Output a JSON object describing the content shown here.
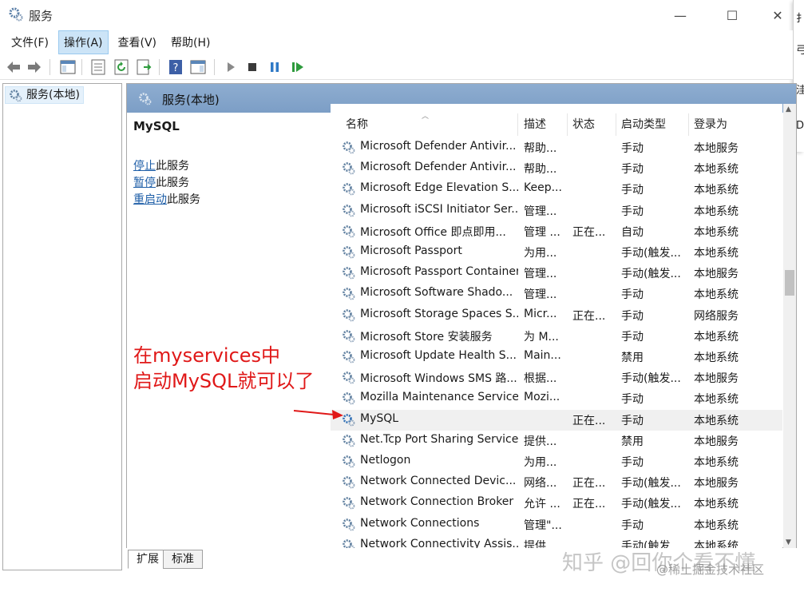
{
  "window": {
    "title": "服务",
    "minimize_glyph": "—",
    "maximize_glyph": "☐",
    "close_glyph": "✕"
  },
  "side_strip": [
    "扌",
    "弓",
    "洼",
    "D"
  ],
  "menu": [
    {
      "label": "文件(F)",
      "active": false
    },
    {
      "label": "操作(A)",
      "active": true
    },
    {
      "label": "查看(V)",
      "active": false
    },
    {
      "label": "帮助(H)",
      "active": false
    }
  ],
  "toolbar_icons": [
    "back-arrow-icon",
    "forward-arrow-icon",
    "show-console-tree-icon",
    "properties-icon",
    "refresh-icon",
    "export-list-icon",
    "help-icon",
    "action-pane-icon",
    "start-service-icon",
    "stop-service-icon",
    "pause-service-icon",
    "restart-service-icon"
  ],
  "tree": {
    "label": "服务(本地)"
  },
  "header": {
    "title": "服务(本地)"
  },
  "extended": {
    "service_name": "MySQL",
    "actions": [
      {
        "link": "停止",
        "suffix": "此服务"
      },
      {
        "link": "暂停",
        "suffix": "此服务"
      },
      {
        "link": "重启动",
        "suffix": "此服务"
      }
    ]
  },
  "annotation": {
    "line1": "在myservices中",
    "line2": "启动MySQL就可以了",
    "color": "#e01818"
  },
  "columns": {
    "name": "名称",
    "desc": "描述",
    "status": "状态",
    "startup": "启动类型",
    "logon": "登录为"
  },
  "rows": [
    {
      "name": "Microsoft Defender Antivir...",
      "desc": "帮助...",
      "status": "",
      "startup": "手动",
      "logon": "本地服务"
    },
    {
      "name": "Microsoft Defender Antivir...",
      "desc": "帮助...",
      "status": "",
      "startup": "手动",
      "logon": "本地系统"
    },
    {
      "name": "Microsoft Edge Elevation S...",
      "desc": "Keep...",
      "status": "",
      "startup": "手动",
      "logon": "本地系统"
    },
    {
      "name": "Microsoft iSCSI Initiator Ser...",
      "desc": "管理...",
      "status": "",
      "startup": "手动",
      "logon": "本地系统"
    },
    {
      "name": "Microsoft Office 即点即用...",
      "desc": "管理 ...",
      "status": "正在...",
      "startup": "自动",
      "logon": "本地系统"
    },
    {
      "name": "Microsoft Passport",
      "desc": "为用...",
      "status": "",
      "startup": "手动(触发...",
      "logon": "本地系统"
    },
    {
      "name": "Microsoft Passport Container",
      "desc": "管理...",
      "status": "",
      "startup": "手动(触发...",
      "logon": "本地服务"
    },
    {
      "name": "Microsoft Software Shado...",
      "desc": "管理...",
      "status": "",
      "startup": "手动",
      "logon": "本地系统"
    },
    {
      "name": "Microsoft Storage Spaces S...",
      "desc": "Micr...",
      "status": "正在...",
      "startup": "手动",
      "logon": "网络服务"
    },
    {
      "name": "Microsoft Store 安装服务",
      "desc": "为 M...",
      "status": "",
      "startup": "手动",
      "logon": "本地系统"
    },
    {
      "name": "Microsoft Update Health S...",
      "desc": "Main...",
      "status": "",
      "startup": "禁用",
      "logon": "本地系统"
    },
    {
      "name": "Microsoft Windows SMS 路...",
      "desc": "根据...",
      "status": "",
      "startup": "手动(触发...",
      "logon": "本地服务"
    },
    {
      "name": "Mozilla Maintenance Service",
      "desc": "Mozi...",
      "status": "",
      "startup": "手动",
      "logon": "本地系统"
    },
    {
      "name": "MySQL",
      "desc": "",
      "status": "正在...",
      "startup": "手动",
      "logon": "本地系统",
      "selected": true
    },
    {
      "name": "Net.Tcp Port Sharing Service",
      "desc": "提供...",
      "status": "",
      "startup": "禁用",
      "logon": "本地服务"
    },
    {
      "name": "Netlogon",
      "desc": "为用...",
      "status": "",
      "startup": "手动",
      "logon": "本地系统"
    },
    {
      "name": "Network Connected Devic...",
      "desc": "网络...",
      "status": "正在...",
      "startup": "手动(触发...",
      "logon": "本地服务"
    },
    {
      "name": "Network Connection Broker",
      "desc": "允许 ...",
      "status": "正在...",
      "startup": "手动(触发...",
      "logon": "本地系统"
    },
    {
      "name": "Network Connections",
      "desc": "管理\"...",
      "status": "",
      "startup": "手动",
      "logon": "本地系统"
    },
    {
      "name": "Network Connectivity Assis...",
      "desc": "提供...",
      "status": "",
      "startup": "手动(触发...",
      "logon": "本地系统"
    }
  ],
  "tabs": [
    "扩展",
    "标准"
  ],
  "watermark": {
    "main": "知乎 @回你个看不懂",
    "sub": "@稀土掘金技术社区"
  }
}
